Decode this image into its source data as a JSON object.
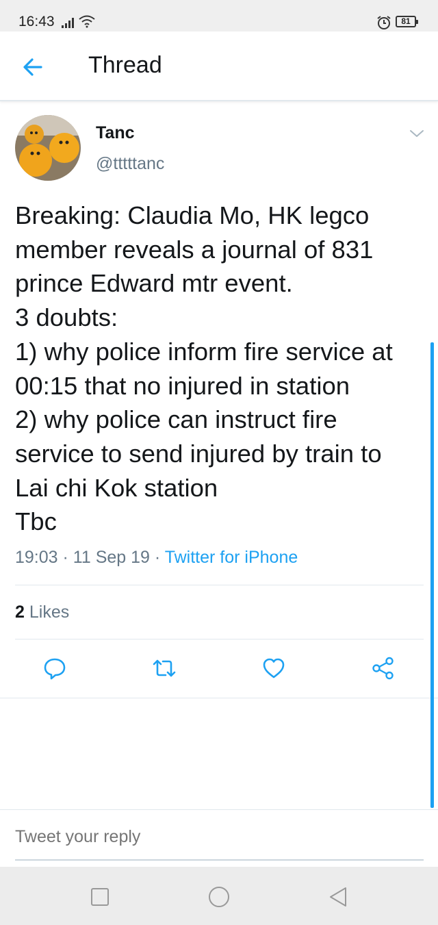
{
  "status_bar": {
    "time": "16:43",
    "battery": "81",
    "icons": [
      "signal-icon",
      "wifi-icon",
      "alarm-icon",
      "battery-icon"
    ]
  },
  "header": {
    "back_icon": "arrow-left-icon",
    "title": "Thread"
  },
  "tweet": {
    "display_name": "Tanc",
    "handle": "@tttttanc",
    "lines": [
      "Breaking: Claudia Mo, HK legco",
      "member reveals a journal of 831",
      "prince Edward mtr event.",
      "3 doubts:",
      "1) why police inform fire service at",
      "00:15 that no injured in station",
      "2) why police can instruct fire",
      "service to send injured by train to",
      "Lai chi Kok station",
      "Tbc"
    ],
    "time": "19:03",
    "date": "11 Sep 19",
    "source": "Twitter for iPhone",
    "separator": "·",
    "likes_count": "2",
    "likes_label": "Likes",
    "actions": [
      "reply-icon",
      "retweet-icon",
      "like-icon",
      "share-icon"
    ]
  },
  "reply": {
    "placeholder": "Tweet your reply"
  },
  "nav": {
    "buttons": [
      "recents-button",
      "home-button",
      "back-button"
    ]
  },
  "colors": {
    "accent": "#1da1f2",
    "text": "#14171a",
    "secondary": "#657786",
    "divider": "#e1e8ed"
  }
}
